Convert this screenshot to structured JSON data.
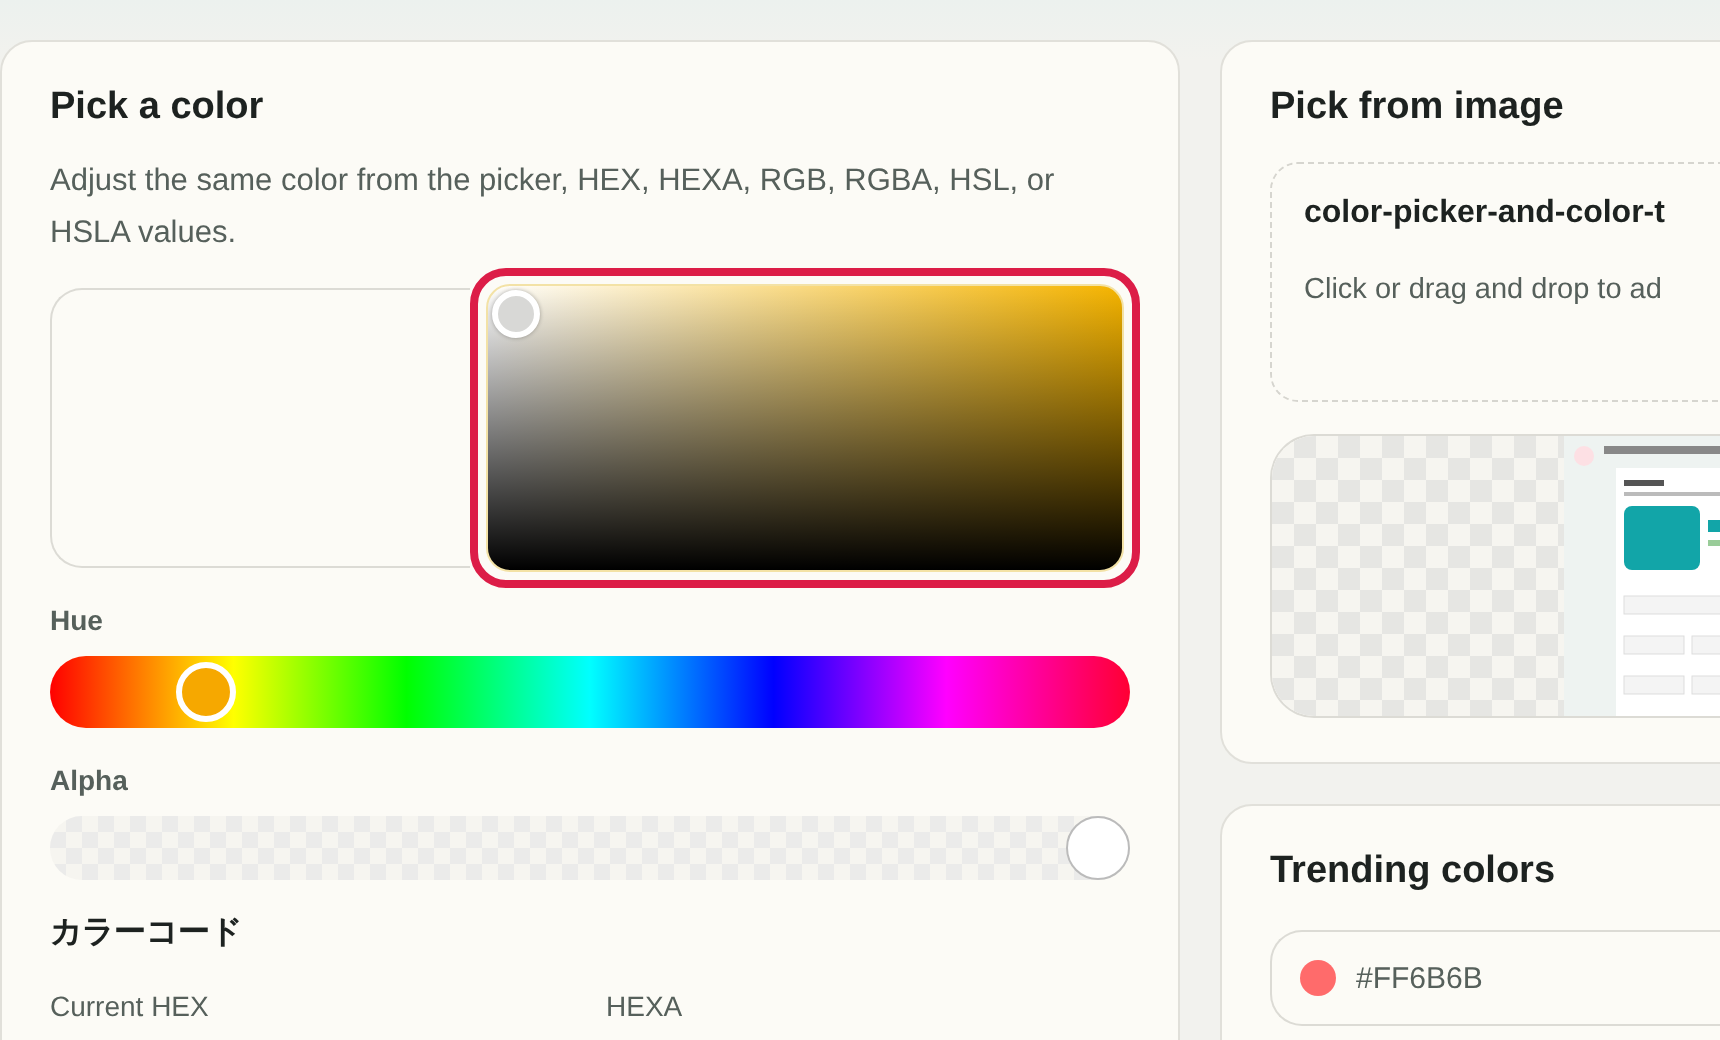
{
  "color_panel": {
    "title": "Pick a color",
    "description": "Adjust the same color from the picker, HEX, HEXA, RGB, RGBA, HSL, or HSLA values.",
    "picker_highlighted": true,
    "hue": {
      "label": "Hue",
      "level": 0.12
    },
    "alpha": {
      "label": "Alpha",
      "level": 1
    },
    "codes": {
      "title": "カラーコード",
      "fields": [
        {
          "label": "Current HEX"
        },
        {
          "label": "HEXA"
        }
      ]
    }
  },
  "image_panel": {
    "title": "Pick from image",
    "file_name": "color-picker-and-color-t",
    "hint": "Click or drag and drop to ad"
  },
  "trending": {
    "title": "Trending colors",
    "items": [
      {
        "code": "#FF6B6B",
        "color": "#ff6b6b"
      }
    ]
  }
}
